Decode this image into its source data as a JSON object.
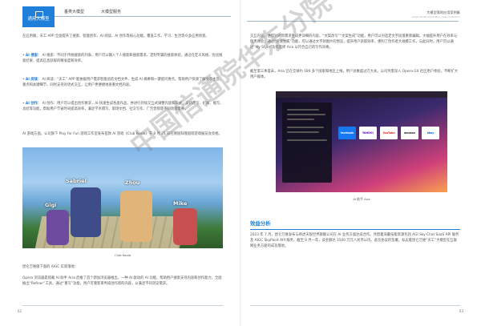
{
  "header_left": {
    "tab_label": "通用大模型",
    "nav": [
      "垂类大模型",
      "大模型服务"
    ]
  },
  "header_right": {
    "title": "大模型落地应用案例集",
    "subtitle": "Large Model Application Case Collection"
  },
  "left_page": {
    "paragraphs": [
      "在应用端，天工 APP 全面提升了搜索、智能创作、AI 阅读、AI 创作等核心功能，覆盖工作、学习、生活等众多应用场景。",
      "AI 搜索：不同于传统搜索的列表，用户可以输入个人搜索和搜索需求，定制专属的搜索体验，通过在定义风格、优化搜索结果，提高信息获取的精准度和效率。",
      "AI 阅读：“天工” APP 能依据用户需求智能总结文档文件、生成 AI 摘要和一键提问要点，帮助用户快速了解文章主旨，重点和关键细节，同时支持对话式交互，让用户更便捷地查看文档内容。",
      "AI 创作：用户可以提出创作要求，AI 快速生成各类作品，并进行持续交互式调整内容和形式，支持改写、扩展、缩写、总结等功能，帮助用户节省时间提高效率，满足学术撰写、职场文档、社交写作、广告营销等不同场景需要。",
      "AI 游戏方面，公司旗下 Play for Fun 游戏工作室发布首款 AI 游戏《Club Koala》于 8 月 25 日在德国科隆国际游戏展览会亮相。"
    ],
    "bold_leads": [
      "AI 搜索：",
      "AI 阅读：",
      "AI 创作："
    ],
    "image_caption": "Club Koala",
    "game_tags": [
      "Sabriel",
      "Zhou",
      "Gigi",
      "Mike"
    ],
    "after_image_paragraphs": [
      "昆仑万维旗下面的 AIGC 实际落地：",
      "Opera 浏览器是搭载 AI 助手 Aria 后推了首个新加浏览器推出，一种 AI 驱动的 AI 功能，帮助用户搜索支持内容和创作能力，全面推出“Refiner”工具，通过“重写”功能，用户可重新审判或创作新的内容，以满足不同浏览需求。"
    ],
    "page_number": "62"
  },
  "right_page": {
    "paragraphs": [
      "交互内容，便可针对新需求生成更详细的内容，“文案改写”“文案生成”功能，用户可以对选定文字段落重新编辑，大幅提升用户在效率与使用体验；通过“快速生成”功能，可以通过文字转图片的预览，提升用户获取效率，便利了创作者大规模工作，与此同时，用户可以通过“My Style”功能选择 Aria 以符合自己的写作风格。",
      "截至第三季度末，Aria 已在全球约 180 多个国家和地区上线，用户总数超过万大关。公司凭借深入 Opera GX 社区用户体验，不断扩大用户群体。"
    ],
    "image_caption": "AI 助手 Aria",
    "browser_tiles": [
      "facebook",
      "YAHOO!",
      "YouTube",
      "amazon",
      "ebay"
    ],
    "section_title": "效益分析",
    "section_paragraph": "2023 年 7 月，昆仑万维发布与奇虎天锐世界旗舰公司在 AI 业务方面达成合作。凭借着海量技能资源包括 AGI Sky-Chat SaaS API 服务及 AIGC SkyPaint API 服务，截至 9 月一年，该金额达 1500 万元人民币以内。此次协议的签署，标志着昆仑万维“天工”大模型在互联网业务方面的成功落地。",
    "page_number": "63"
  },
  "watermark": "中国信通院华东分院",
  "colors": {
    "accent": "#1f7fd9",
    "text": "#555555"
  }
}
